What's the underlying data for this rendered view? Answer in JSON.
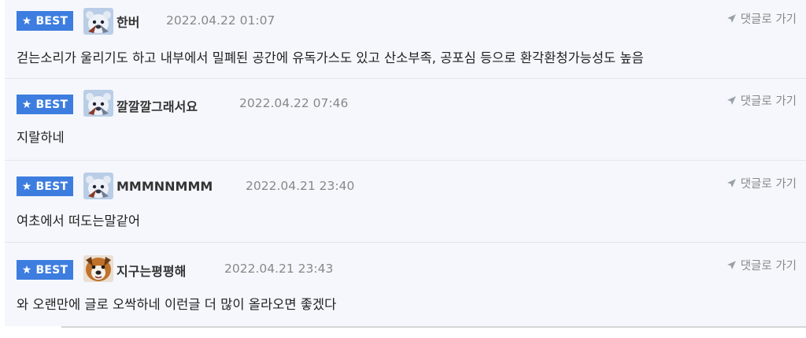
{
  "comments": [
    {
      "badge": "BEST",
      "nickname": "한버",
      "date": "2022.04.22 01:07",
      "reply_label": "댓글로 가기",
      "body": "걷는소리가 울리기도 하고 내부에서 밀폐된 공간에 유독가스도 있고 산소부족, 공포심 등으로 환각환청가능성도 높음",
      "avatar": "bear-avatar"
    },
    {
      "badge": "BEST",
      "nickname": "깔깔깔그래서요",
      "date": "2022.04.22 07:46",
      "reply_label": "댓글로 가기",
      "body": "지랄하네",
      "avatar": "bear-avatar"
    },
    {
      "badge": "BEST",
      "nickname": "MMMNNMMM",
      "date": "2022.04.21 23:40",
      "reply_label": "댓글로 가기",
      "body": "여초에서 떠도는말같어",
      "avatar": "bear-avatar"
    },
    {
      "badge": "BEST",
      "nickname": "지구는평평해",
      "date": "2022.04.21 23:43",
      "reply_label": "댓글로 가기",
      "body": "와 오랜만에 글로 오싹하네 이런글 더 많이 올라오면 좋겠다",
      "avatar": "dog-avatar"
    }
  ],
  "colors": {
    "badge_bg": "#3d7ddf",
    "panel_bg": "#f5f7fc",
    "meta_text": "#888888"
  }
}
